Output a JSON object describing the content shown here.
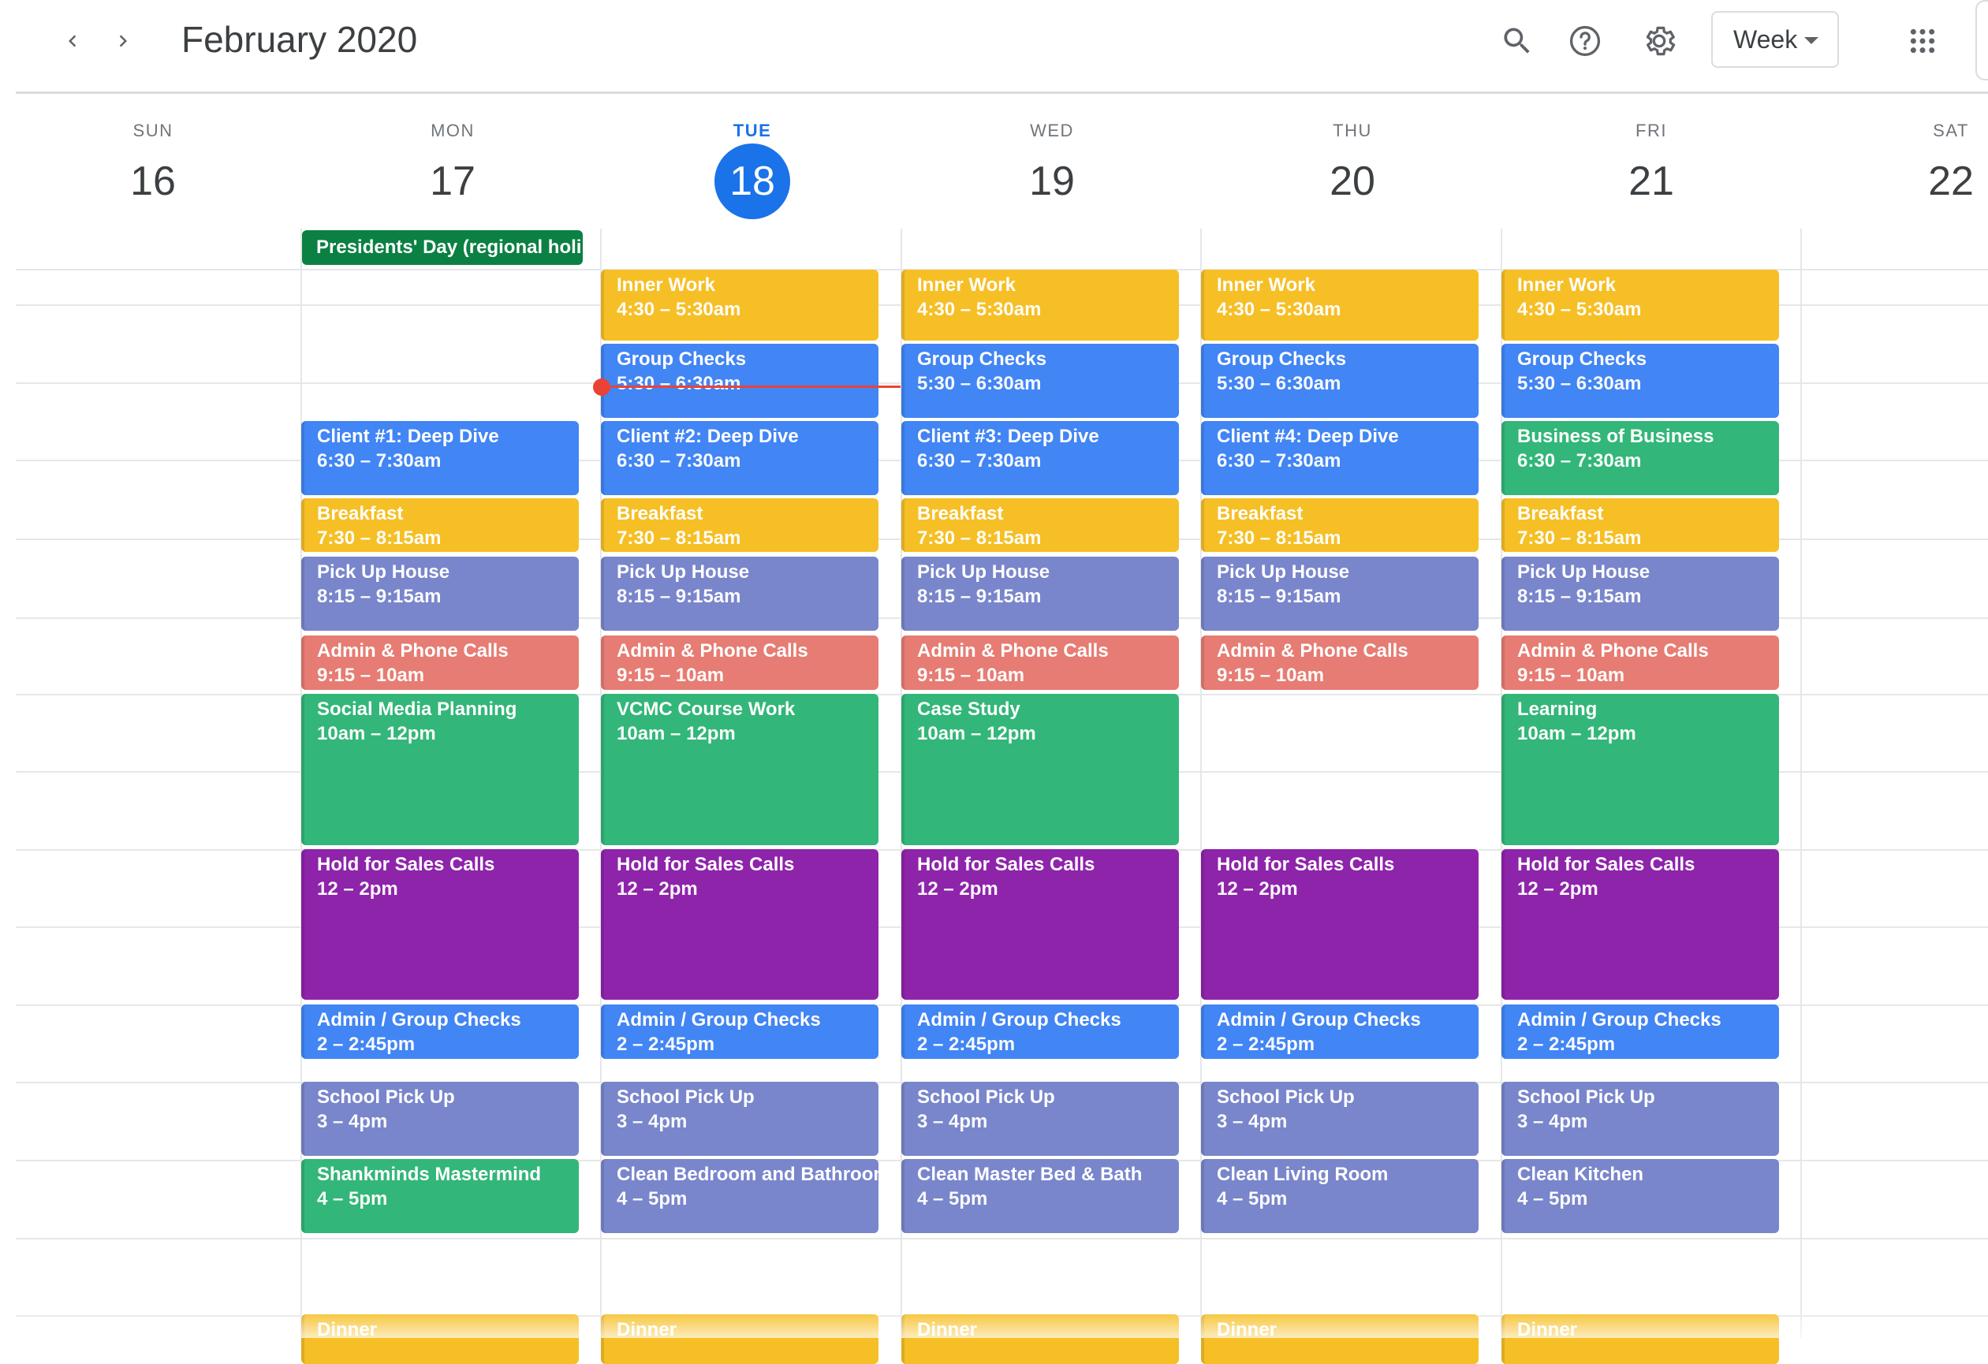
{
  "header": {
    "title": "February 2020",
    "view_label": "Week",
    "icons": [
      "chevron-left-icon",
      "chevron-right-icon",
      "search-icon",
      "help-icon",
      "gear-icon",
      "apps-grid-icon"
    ]
  },
  "days": [
    {
      "name": "SUN",
      "num": "16"
    },
    {
      "name": "MON",
      "num": "17"
    },
    {
      "name": "TUE",
      "num": "18"
    },
    {
      "name": "WED",
      "num": "19"
    },
    {
      "name": "THU",
      "num": "20"
    },
    {
      "name": "FRI",
      "num": "21"
    },
    {
      "name": "SAT",
      "num": "22"
    }
  ],
  "today_index": 2,
  "all_day": {
    "day": 1,
    "title": "Presidents' Day (regional holi"
  },
  "colors": {
    "banana": "#f6bf26",
    "blueberry": "#4285f4",
    "lavender": "#7986cb",
    "flamingo": "#e67c73",
    "sage": "#33b679",
    "grape": "#8e24aa",
    "basil": "#0b8043",
    "today": "#1a73e8",
    "now": "#ea4335"
  },
  "events": [
    {
      "day": 2,
      "slot": "s430",
      "title": "Inner Work",
      "time": "4:30 – 5:30am",
      "color": "banana"
    },
    {
      "day": 3,
      "slot": "s430",
      "title": "Inner Work",
      "time": "4:30 – 5:30am",
      "color": "banana"
    },
    {
      "day": 4,
      "slot": "s430",
      "title": "Inner Work",
      "time": "4:30 – 5:30am",
      "color": "banana"
    },
    {
      "day": 5,
      "slot": "s430",
      "title": "Inner Work",
      "time": "4:30 – 5:30am",
      "color": "banana"
    },
    {
      "day": 2,
      "slot": "s530",
      "title": "Group Checks",
      "time": "5:30 – 6:30am",
      "color": "blueberry"
    },
    {
      "day": 3,
      "slot": "s530",
      "title": "Group Checks",
      "time": "5:30 – 6:30am",
      "color": "blueberry"
    },
    {
      "day": 4,
      "slot": "s530",
      "title": "Group Checks",
      "time": "5:30 – 6:30am",
      "color": "blueberry"
    },
    {
      "day": 5,
      "slot": "s530",
      "title": "Group Checks",
      "time": "5:30 – 6:30am",
      "color": "blueberry"
    },
    {
      "day": 1,
      "slot": "s630",
      "title": "Client #1: Deep Dive",
      "time": "6:30 – 7:30am",
      "color": "blueberry"
    },
    {
      "day": 2,
      "slot": "s630",
      "title": "Client #2: Deep Dive",
      "time": "6:30 – 7:30am",
      "color": "blueberry"
    },
    {
      "day": 3,
      "slot": "s630",
      "title": "Client #3: Deep Dive",
      "time": "6:30 – 7:30am",
      "color": "blueberry"
    },
    {
      "day": 4,
      "slot": "s630",
      "title": "Client #4: Deep Dive",
      "time": "6:30 – 7:30am",
      "color": "blueberry"
    },
    {
      "day": 5,
      "slot": "s630",
      "title": "Business of Business",
      "time": "6:30 – 7:30am",
      "color": "sage"
    },
    {
      "day": 1,
      "slot": "s730",
      "title": "Breakfast",
      "time": "7:30 – 8:15am",
      "color": "banana"
    },
    {
      "day": 2,
      "slot": "s730",
      "title": "Breakfast",
      "time": "7:30 – 8:15am",
      "color": "banana"
    },
    {
      "day": 3,
      "slot": "s730",
      "title": "Breakfast",
      "time": "7:30 – 8:15am",
      "color": "banana"
    },
    {
      "day": 4,
      "slot": "s730",
      "title": "Breakfast",
      "time": "7:30 – 8:15am",
      "color": "banana"
    },
    {
      "day": 5,
      "slot": "s730",
      "title": "Breakfast",
      "time": "7:30 – 8:15am",
      "color": "banana"
    },
    {
      "day": 1,
      "slot": "s815",
      "title": "Pick Up House",
      "time": "8:15 – 9:15am",
      "color": "lavender"
    },
    {
      "day": 2,
      "slot": "s815",
      "title": "Pick Up House",
      "time": "8:15 – 9:15am",
      "color": "lavender"
    },
    {
      "day": 3,
      "slot": "s815",
      "title": "Pick Up House",
      "time": "8:15 – 9:15am",
      "color": "lavender"
    },
    {
      "day": 4,
      "slot": "s815",
      "title": "Pick Up House",
      "time": "8:15 – 9:15am",
      "color": "lavender"
    },
    {
      "day": 5,
      "slot": "s815",
      "title": "Pick Up House",
      "time": "8:15 – 9:15am",
      "color": "lavender"
    },
    {
      "day": 1,
      "slot": "s915",
      "title": "Admin & Phone Calls",
      "time": "9:15 – 10am",
      "color": "flamingo"
    },
    {
      "day": 2,
      "slot": "s915",
      "title": "Admin & Phone Calls",
      "time": "9:15 – 10am",
      "color": "flamingo"
    },
    {
      "day": 3,
      "slot": "s915",
      "title": "Admin & Phone Calls",
      "time": "9:15 – 10am",
      "color": "flamingo"
    },
    {
      "day": 4,
      "slot": "s915",
      "title": "Admin & Phone Calls",
      "time": "9:15 – 10am",
      "color": "flamingo"
    },
    {
      "day": 5,
      "slot": "s915",
      "title": "Admin & Phone Calls",
      "time": "9:15 – 10am",
      "color": "flamingo"
    },
    {
      "day": 1,
      "slot": "s10",
      "title": "Social Media Planning",
      "time": "10am – 12pm",
      "color": "sage"
    },
    {
      "day": 2,
      "slot": "s10",
      "title": "VCMC Course Work",
      "time": "10am – 12pm",
      "color": "sage"
    },
    {
      "day": 3,
      "slot": "s10",
      "title": "Case Study",
      "time": "10am – 12pm",
      "color": "sage"
    },
    {
      "day": 5,
      "slot": "s10",
      "title": "Learning",
      "time": "10am – 12pm",
      "color": "sage"
    },
    {
      "day": 1,
      "slot": "s12",
      "title": "Hold for Sales Calls",
      "time": "12 – 2pm",
      "color": "grape"
    },
    {
      "day": 2,
      "slot": "s12",
      "title": "Hold for Sales Calls",
      "time": "12 – 2pm",
      "color": "grape"
    },
    {
      "day": 3,
      "slot": "s12",
      "title": "Hold for Sales Calls",
      "time": "12 – 2pm",
      "color": "grape"
    },
    {
      "day": 4,
      "slot": "s12",
      "title": "Hold for Sales Calls",
      "time": "12 – 2pm",
      "color": "grape"
    },
    {
      "day": 5,
      "slot": "s12",
      "title": "Hold for Sales Calls",
      "time": "12 – 2pm",
      "color": "grape"
    },
    {
      "day": 1,
      "slot": "s2",
      "title": "Admin / Group Checks",
      "time": "2 – 2:45pm",
      "color": "blueberry"
    },
    {
      "day": 2,
      "slot": "s2",
      "title": "Admin / Group Checks",
      "time": "2 – 2:45pm",
      "color": "blueberry"
    },
    {
      "day": 3,
      "slot": "s2",
      "title": "Admin / Group Checks",
      "time": "2 – 2:45pm",
      "color": "blueberry"
    },
    {
      "day": 4,
      "slot": "s2",
      "title": "Admin / Group Checks",
      "time": "2 – 2:45pm",
      "color": "blueberry"
    },
    {
      "day": 5,
      "slot": "s2",
      "title": "Admin / Group Checks",
      "time": "2 – 2:45pm",
      "color": "blueberry"
    },
    {
      "day": 1,
      "slot": "s3",
      "title": "School Pick Up",
      "time": "3 – 4pm",
      "color": "lavender"
    },
    {
      "day": 2,
      "slot": "s3",
      "title": "School Pick Up",
      "time": "3 – 4pm",
      "color": "lavender"
    },
    {
      "day": 3,
      "slot": "s3",
      "title": "School Pick Up",
      "time": "3 – 4pm",
      "color": "lavender"
    },
    {
      "day": 4,
      "slot": "s3",
      "title": "School Pick Up",
      "time": "3 – 4pm",
      "color": "lavender"
    },
    {
      "day": 5,
      "slot": "s3",
      "title": "School Pick Up",
      "time": "3 – 4pm",
      "color": "lavender"
    },
    {
      "day": 1,
      "slot": "s4",
      "title": "Shankminds Mastermind",
      "time": "4 – 5pm",
      "color": "sage"
    },
    {
      "day": 2,
      "slot": "s4",
      "title": "Clean Bedroom and Bathroom",
      "time": "4 – 5pm",
      "color": "lavender"
    },
    {
      "day": 3,
      "slot": "s4",
      "title": "Clean Master Bed & Bath",
      "time": "4 – 5pm",
      "color": "lavender"
    },
    {
      "day": 4,
      "slot": "s4",
      "title": "Clean Living Room",
      "time": "4 – 5pm",
      "color": "lavender"
    },
    {
      "day": 5,
      "slot": "s4",
      "title": "Clean Kitchen",
      "time": "4 – 5pm",
      "color": "lavender"
    },
    {
      "day": 1,
      "slot": "s6",
      "title": "Dinner",
      "time": "",
      "color": "banana"
    },
    {
      "day": 2,
      "slot": "s6",
      "title": "Dinner",
      "time": "",
      "color": "banana"
    },
    {
      "day": 3,
      "slot": "s6",
      "title": "Dinner",
      "time": "",
      "color": "banana"
    },
    {
      "day": 4,
      "slot": "s6",
      "title": "Dinner",
      "time": "",
      "color": "banana"
    },
    {
      "day": 5,
      "slot": "s6",
      "title": "Dinner",
      "time": "",
      "color": "banana"
    }
  ]
}
